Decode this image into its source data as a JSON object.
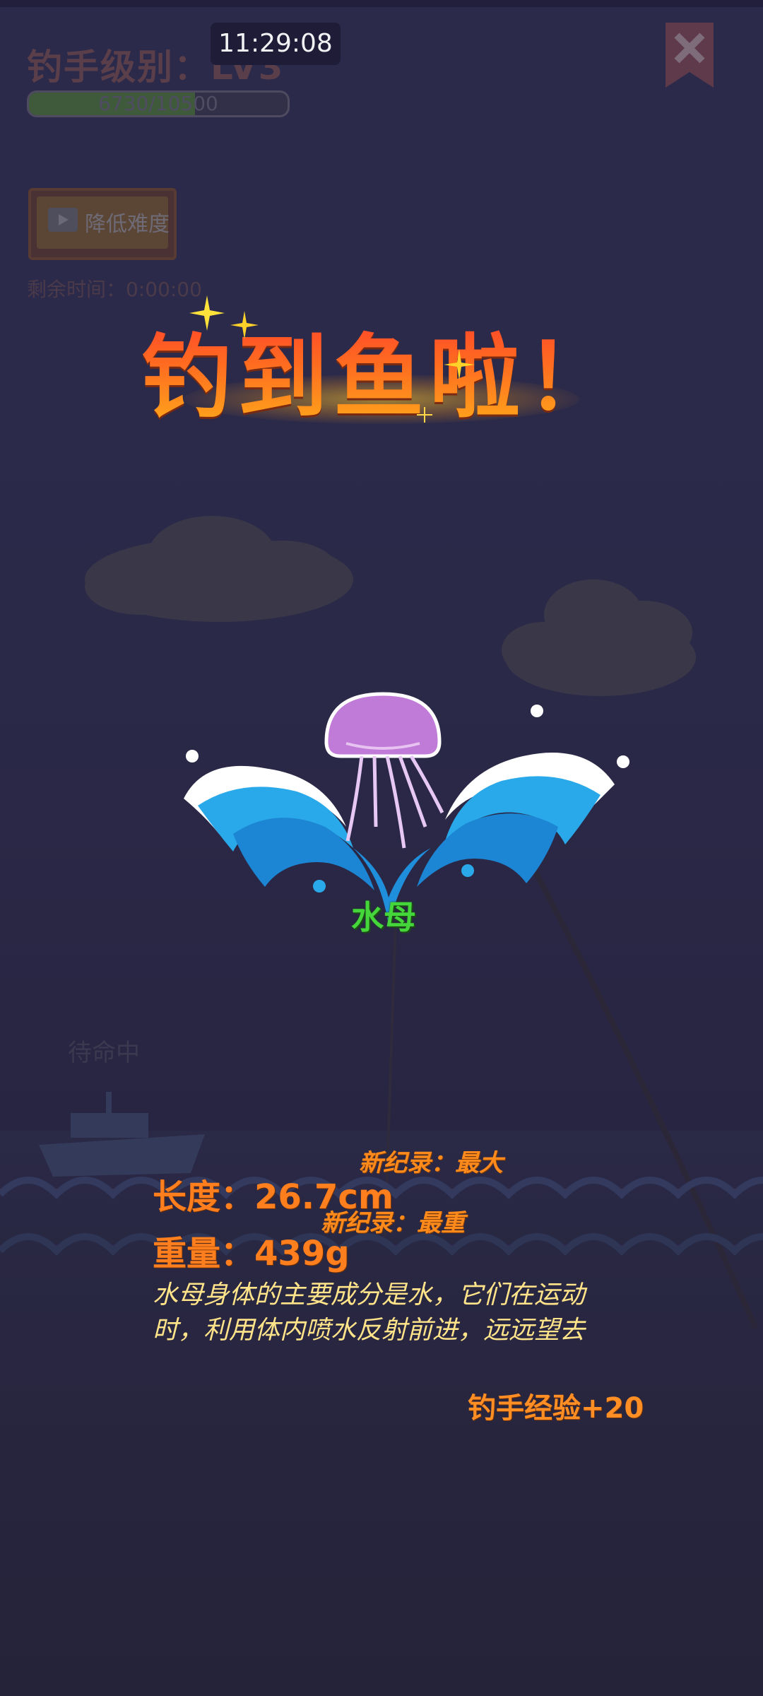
{
  "status_bar": {
    "time": "11:29:08"
  },
  "hud": {
    "angler_level": "钓手级别：LV3",
    "exp_progress_text": "6730/10500",
    "exp_progress_fraction": 0.641,
    "reduce_difficulty_label": "降低难度",
    "remaining_time": "剩余时间：0:00:00",
    "standby_text": "待命中"
  },
  "catch": {
    "title": "钓到鱼啦！",
    "fish_name": "水母",
    "new_record_length": "新纪录：最大",
    "new_record_weight": "新纪录：最重",
    "length_label": "长度：26.7cm",
    "weight_label": "重量：439g",
    "description_line1": "水母身体的主要成分是水，它们在运动",
    "description_line2": "时，利用体内喷水反射前进，远远望去",
    "exp_gain": "钓手经验+20"
  },
  "icons": {
    "close": "close-icon",
    "play": "play-icon",
    "jellyfish": "jellyfish-icon",
    "splash": "water-splash-icon",
    "boat": "boat-icon"
  },
  "colors": {
    "background": "#2a2846",
    "title_gradient_top": "#ff3b2e",
    "title_gradient_bottom": "#ffb01a",
    "stat_orange": "#ff7f1e",
    "fish_name_green": "#44d63a",
    "description_yellow": "#ffe48a"
  }
}
